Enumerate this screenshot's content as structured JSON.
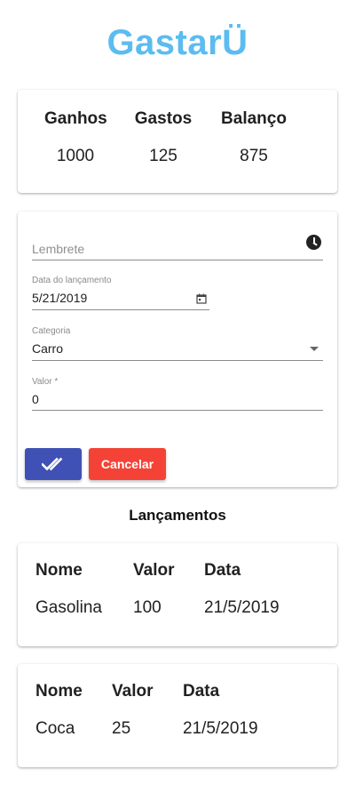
{
  "app": {
    "title": "GastarÜ"
  },
  "summary": {
    "headers": {
      "income": "Ganhos",
      "expenses": "Gastos",
      "balance": "Balanço"
    },
    "values": {
      "income": "1000",
      "expenses": "125",
      "balance": "875"
    }
  },
  "form": {
    "reminder": {
      "placeholder": "Lembrete",
      "icon": "clock-icon"
    },
    "date": {
      "label": "Data do lançamento",
      "value": "5/21/2019",
      "icon": "calendar-icon"
    },
    "category": {
      "label": "Categoria",
      "value": "Carro",
      "icon": "dropdown-arrow-icon"
    },
    "amount": {
      "label": "Valor *",
      "value": "0"
    },
    "confirm_icon": "check-all-icon",
    "cancel_label": "Cancelar",
    "colors": {
      "confirm": "#3f51b5",
      "cancel": "#f44336"
    }
  },
  "entries_section": {
    "title": "Lançamentos"
  },
  "entries": [
    {
      "headers": {
        "name": "Nome",
        "value": "Valor",
        "date": "Data"
      },
      "name": "Gasolina",
      "value": "100",
      "date": "21/5/2019"
    },
    {
      "headers": {
        "name": "Nome",
        "value": "Valor",
        "date": "Data"
      },
      "name": "Coca",
      "value": "25",
      "date": "21/5/2019"
    }
  ],
  "colors": {
    "brand": "#5bbcf0"
  }
}
